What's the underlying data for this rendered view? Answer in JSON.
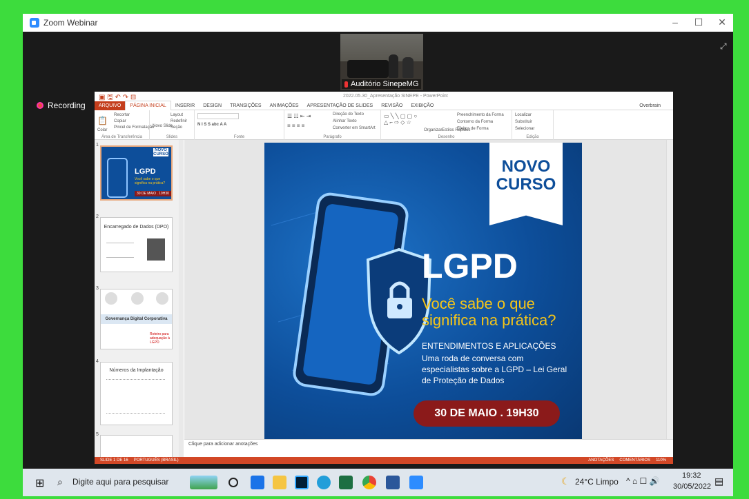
{
  "window": {
    "title": "Zoom Webinar",
    "controls": [
      "–",
      "☐",
      "✕"
    ]
  },
  "video": {
    "participant": "Auditório SinepeMG"
  },
  "recording": {
    "label": "Recording"
  },
  "powerpoint": {
    "title": "2022.05.30_Apresentação SINEPE - PowerPoint",
    "tabs": [
      "ARQUIVO",
      "PÁGINA INICIAL",
      "INSERIR",
      "DESIGN",
      "TRANSIÇÕES",
      "ANIMAÇÕES",
      "APRESENTAÇÃO DE SLIDES",
      "REVISÃO",
      "EXIBIÇÃO"
    ],
    "user": "Overbrain",
    "ribbon": {
      "clipboard": {
        "label": "Área de Transferência",
        "paste": "Colar",
        "cut": "Recortar",
        "copy": "Copiar",
        "format": "Pincel de Formatação"
      },
      "slides": {
        "label": "Slides",
        "new": "Novo Slide",
        "layout": "Layout",
        "reset": "Redefinir",
        "section": "Seção"
      },
      "font": {
        "label": "Fonte"
      },
      "paragraph": {
        "label": "Parágrafo",
        "dir": "Direção do Texto",
        "align": "Alinhar Texto",
        "smart": "Converter em SmartArt"
      },
      "drawing": {
        "label": "Desenho",
        "arrange": "Organizar",
        "styles": "Estilos Rápidos",
        "fill": "Preenchimento da Forma",
        "outline": "Contorno da Forma",
        "effects": "Efeitos de Forma"
      },
      "edit": {
        "label": "Edição",
        "find": "Localizar",
        "replace": "Substituir",
        "select": "Selecionar"
      }
    },
    "thumbs": [
      {
        "num": "1",
        "title": "LGPD",
        "sub": "Você sabe o que significa na prática?",
        "date": "30 DE MAIO . 19H30",
        "badge": "NOVO CURSO"
      },
      {
        "num": "2",
        "title": "Encarregado de Dados (DPO)"
      },
      {
        "num": "3",
        "title": "Governança Digital Corporativa",
        "side": "Roteiro para adequação à LGPD"
      },
      {
        "num": "4",
        "title": "Números da Implantação"
      },
      {
        "num": "5",
        "title": ""
      }
    ],
    "slide": {
      "badge_line1": "NOVO",
      "badge_line2": "CURSO",
      "title": "LGPD",
      "question_line1": "Você sabe o que",
      "question_line2": "significa na prática?",
      "sub_heading": "ENTENDIMENTOS E APLICAÇÕES",
      "body_line1": "Uma roda de conversa com",
      "body_line2": "especialistas sobre a LGPD – Lei Geral",
      "body_line3": "de Proteção de Dados",
      "date": "30 DE MAIO . 19H30"
    },
    "notes_placeholder": "Clique para adicionar anotações",
    "status": {
      "slide": "SLIDE 1 DE 16",
      "lang": "PORTUGUÊS (BRASIL)",
      "notes": "ANOTAÇÕES",
      "comments": "COMENTÁRIOS",
      "zoom": "110%"
    }
  },
  "taskbar": {
    "search_placeholder": "Digite aqui para pesquisar",
    "weather": "24°C  Limpo",
    "time": "19:32",
    "date": "30/05/2022"
  },
  "colors": {
    "accent": "#c43e1c",
    "slide_blue": "#0d4e9a",
    "date_red": "#8b1a1a",
    "question_yellow": "#f5c518"
  }
}
